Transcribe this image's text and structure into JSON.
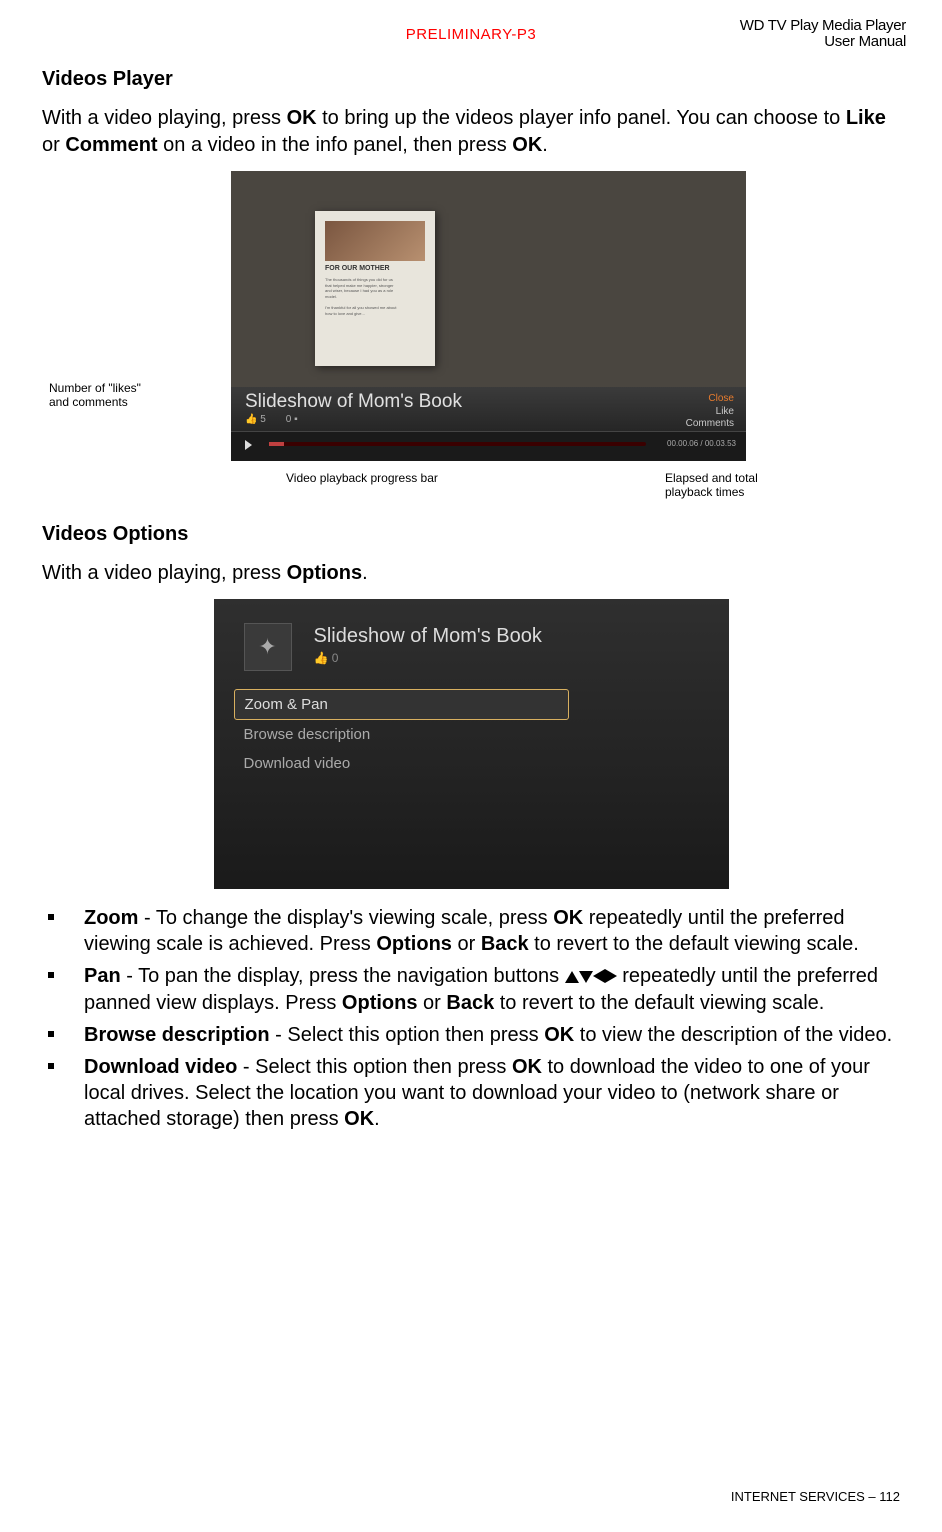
{
  "header": {
    "preliminary": "PRELIMINARY-P3",
    "title_line1": "WD TV Play Media Player",
    "title_line2": "User Manual"
  },
  "section1": {
    "heading": "Videos Player",
    "para_pre": "With a video playing, press ",
    "ok1": "OK",
    "para_mid1": " to bring up the videos player info panel. You can choose to ",
    "like": "Like",
    "para_mid2": " or ",
    "comment": "Comment",
    "para_mid3": " on a video in the info panel, then press ",
    "ok2": "OK",
    "para_end": "."
  },
  "figure1": {
    "card_title": "FOR OUR MOTHER",
    "title": "Slideshow of Mom's Book",
    "likes_count": "5",
    "comments_count": "0",
    "close": "Close",
    "like": "Like",
    "comments": "Comments",
    "time": "00.00.06 / 00.03.53",
    "caption_left": "Number of \"likes\" and comments",
    "caption_center": "Video playback progress bar",
    "caption_right": "Elapsed and total playback times"
  },
  "section2": {
    "heading": "Videos Options",
    "para_pre": "With a video playing, press ",
    "options": "Options",
    "para_end": "."
  },
  "figure2": {
    "title": "Slideshow of Mom's Book",
    "count": "0",
    "opt1": "Zoom & Pan",
    "opt2": "Browse description",
    "opt3": "Download video"
  },
  "bullets": [
    {
      "title": "Zoom",
      "t1": " - To change the display's viewing scale, press ",
      "b1": "OK",
      "t2": " repeatedly until the preferred viewing scale is achieved. Press ",
      "b2": "Options",
      "t3": " or ",
      "b3": "Back",
      "t4": " to revert to the default viewing scale."
    },
    {
      "title": "Pan",
      "t1": " - To pan the display, press the navigation buttons ",
      "t2": " repeatedly until the preferred panned view displays. Press ",
      "b2": "Options",
      "t3": " or ",
      "b3": "Back",
      "t4": " to revert to the default viewing scale."
    },
    {
      "title": "Browse description",
      "t1": " - Select this option then press ",
      "b1": "OK",
      "t2": " to view the description of the video."
    },
    {
      "title": "Download video",
      "t1": " - Select this option then press ",
      "b1": "OK",
      "t2": " to download the video to one of your local drives. Select the location you want to download your video to (network share or attached storage) then press ",
      "b2": "OK",
      "t3": "."
    }
  ],
  "footer": {
    "section": "INTERNET SERVICES",
    "sep": " – ",
    "page": "112"
  }
}
